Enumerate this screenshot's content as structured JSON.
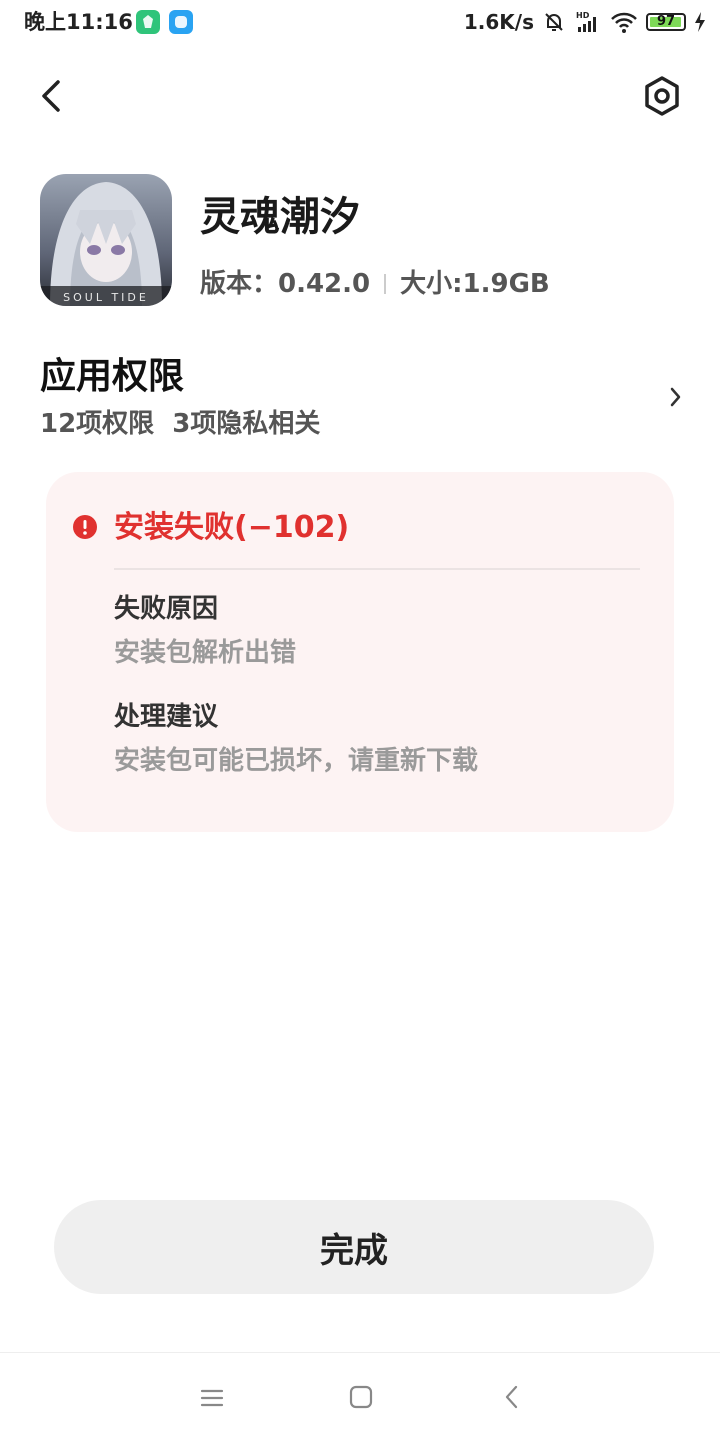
{
  "status_bar": {
    "time": "晚上11:16",
    "net_speed": "1.6K/s",
    "battery_level": "97",
    "battery_fraction": 0.97,
    "icons": [
      "app-green-icon",
      "app-blue-icon",
      "mute-icon",
      "signal-icon",
      "wifi-icon",
      "battery-icon",
      "charging-icon"
    ]
  },
  "header": {
    "back_icon": "chevron-left-icon",
    "settings_icon": "settings-icon"
  },
  "app": {
    "name": "灵魂潮汐",
    "icon_text": "SOUL TIDE",
    "version_label": "版本：0.42.0",
    "size_label": "大小:1.9GB"
  },
  "permissions": {
    "title": "应用权限",
    "summary": "12项权限  3项隐私相关"
  },
  "error": {
    "title": "安装失败(−102)",
    "reason_label": "失败原因",
    "reason_value": "安装包解析出错",
    "suggestion_label": "处理建议",
    "suggestion_value": "安装包可能已损坏，请重新下载",
    "color": "#e0312f"
  },
  "actions": {
    "done_label": "完成"
  },
  "navigation": {
    "icons": [
      "menu-icon",
      "home-icon",
      "back-icon"
    ]
  }
}
